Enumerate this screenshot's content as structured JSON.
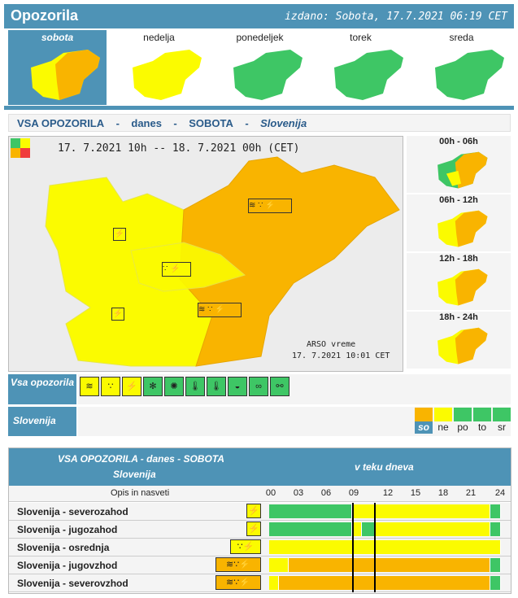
{
  "header": {
    "title": "Opozorila",
    "issued": "izdano: Sobota, 17.7.2021 06:19 CET"
  },
  "days": [
    {
      "label": "sobota",
      "selected": true
    },
    {
      "label": "nedelja",
      "selected": false
    },
    {
      "label": "ponedeljek",
      "selected": false
    },
    {
      "label": "torek",
      "selected": false
    },
    {
      "label": "sreda",
      "selected": false
    }
  ],
  "section": {
    "a": "VSA OPOZORILA",
    "sep": "-",
    "b": "danes",
    "c": "SOBOTA",
    "d": "Slovenija"
  },
  "map": {
    "period": "17. 7.2021  10h  --  18. 7.2021  00h     (CET)",
    "credit": "ARSO vreme",
    "stamp": "17. 7.2021  10:01 CET"
  },
  "slots": [
    "00h - 06h",
    "06h - 12h",
    "12h - 18h",
    "18h - 24h"
  ],
  "filter": {
    "label": "Vsa opozorila",
    "icons": [
      "wind-icon",
      "rain-icon",
      "thunderstorm-icon",
      "snow-icon",
      "ice-icon",
      "high-temperature-icon",
      "low-temperature-icon",
      "coastal-icon",
      "fog-icon",
      "fire-icon"
    ]
  },
  "region": {
    "label": "Slovenija"
  },
  "legend": [
    "so",
    "ne",
    "po",
    "to",
    "sr"
  ],
  "colors": {
    "green": "#3ec665",
    "yellow": "#fbfb00",
    "orange": "#f9b400",
    "red": "#f03c3c",
    "header": "#4e93b6"
  },
  "table": {
    "title": "VSA OPOZORILA - danes - SOBOTA",
    "subtitle": "Slovenija",
    "timeline": "v teku dneva",
    "desc": "Opis in nasveti",
    "hours": [
      "00",
      "03",
      "06",
      "09",
      "12",
      "15",
      "18",
      "21",
      "24"
    ],
    "rows": [
      {
        "name": "Slovenija - severozahod",
        "icons": [
          "thunderstorm-icon"
        ]
      },
      {
        "name": "Slovenija - jugozahod",
        "icons": [
          "thunderstorm-icon"
        ]
      },
      {
        "name": "Slovenija - osrednja",
        "icons": [
          "rain-icon",
          "thunderstorm-icon"
        ]
      },
      {
        "name": "Slovenija - jugovzhod",
        "icons": [
          "wind-icon",
          "rain-icon",
          "thunderstorm-icon"
        ]
      },
      {
        "name": "Slovenija - severovzhod",
        "icons": [
          "wind-icon",
          "rain-icon",
          "thunderstorm-icon"
        ]
      }
    ]
  }
}
